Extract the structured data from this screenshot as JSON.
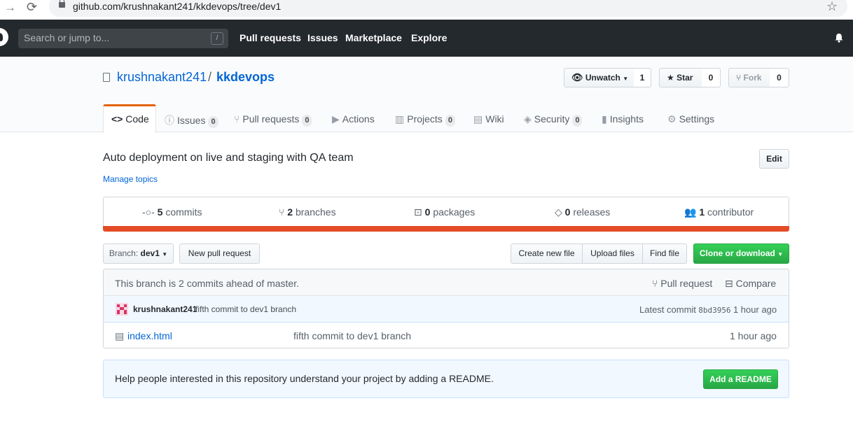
{
  "browser": {
    "url": "github.com/krushnakant241/kkdevops/tree/dev1"
  },
  "header": {
    "search_placeholder": "Search or jump to...",
    "slash_key": "/",
    "nav": [
      "Pull requests",
      "Issues",
      "Marketplace",
      "Explore"
    ]
  },
  "repo": {
    "owner": "krushnakant241",
    "separator": "/",
    "name": "kkdevops",
    "unwatch_label": "Unwatch",
    "watch_count": "1",
    "star_label": "Star",
    "star_count": "0",
    "fork_label": "Fork",
    "fork_count": "0"
  },
  "tabs": {
    "code": "Code",
    "issues": "Issues",
    "issues_count": "0",
    "pulls": "Pull requests",
    "pulls_count": "0",
    "actions": "Actions",
    "projects": "Projects",
    "projects_count": "0",
    "wiki": "Wiki",
    "security": "Security",
    "security_count": "0",
    "insights": "Insights",
    "settings": "Settings"
  },
  "about": {
    "description": "Auto deployment on live and staging with QA team",
    "manage_topics": "Manage topics",
    "edit_label": "Edit"
  },
  "summary": {
    "commits_num": "5",
    "commits_label": "commits",
    "branches_num": "2",
    "branches_label": "branches",
    "packages_num": "0",
    "packages_label": "packages",
    "releases_num": "0",
    "releases_label": "releases",
    "contributors_num": "1",
    "contributors_label": "contributor",
    "language_color": "#e34c26"
  },
  "filenav": {
    "branch_prefix": "Branch:",
    "branch_name": "dev1",
    "new_pr": "New pull request",
    "create_file": "Create new file",
    "upload_files": "Upload files",
    "find_file": "Find file",
    "clone": "Clone or download"
  },
  "ahead": {
    "message": "This branch is 2 commits ahead of master.",
    "pull_request": "Pull request",
    "compare": "Compare"
  },
  "latest_commit": {
    "author": "krushnakant241",
    "message": "fifth commit to dev1 branch",
    "prefix": "Latest commit",
    "sha": "8bd3956",
    "time": "1 hour ago"
  },
  "files": [
    {
      "name": "index.html",
      "message": "fifth commit to dev1 branch",
      "age": "1 hour ago"
    }
  ],
  "readme": {
    "prompt": "Help people interested in this repository understand your project by adding a README.",
    "button": "Add a README"
  },
  "colors": {
    "header_bg": "#24292e",
    "link": "#0366d6",
    "green": "#28a745",
    "tab_accent": "#e36209"
  }
}
